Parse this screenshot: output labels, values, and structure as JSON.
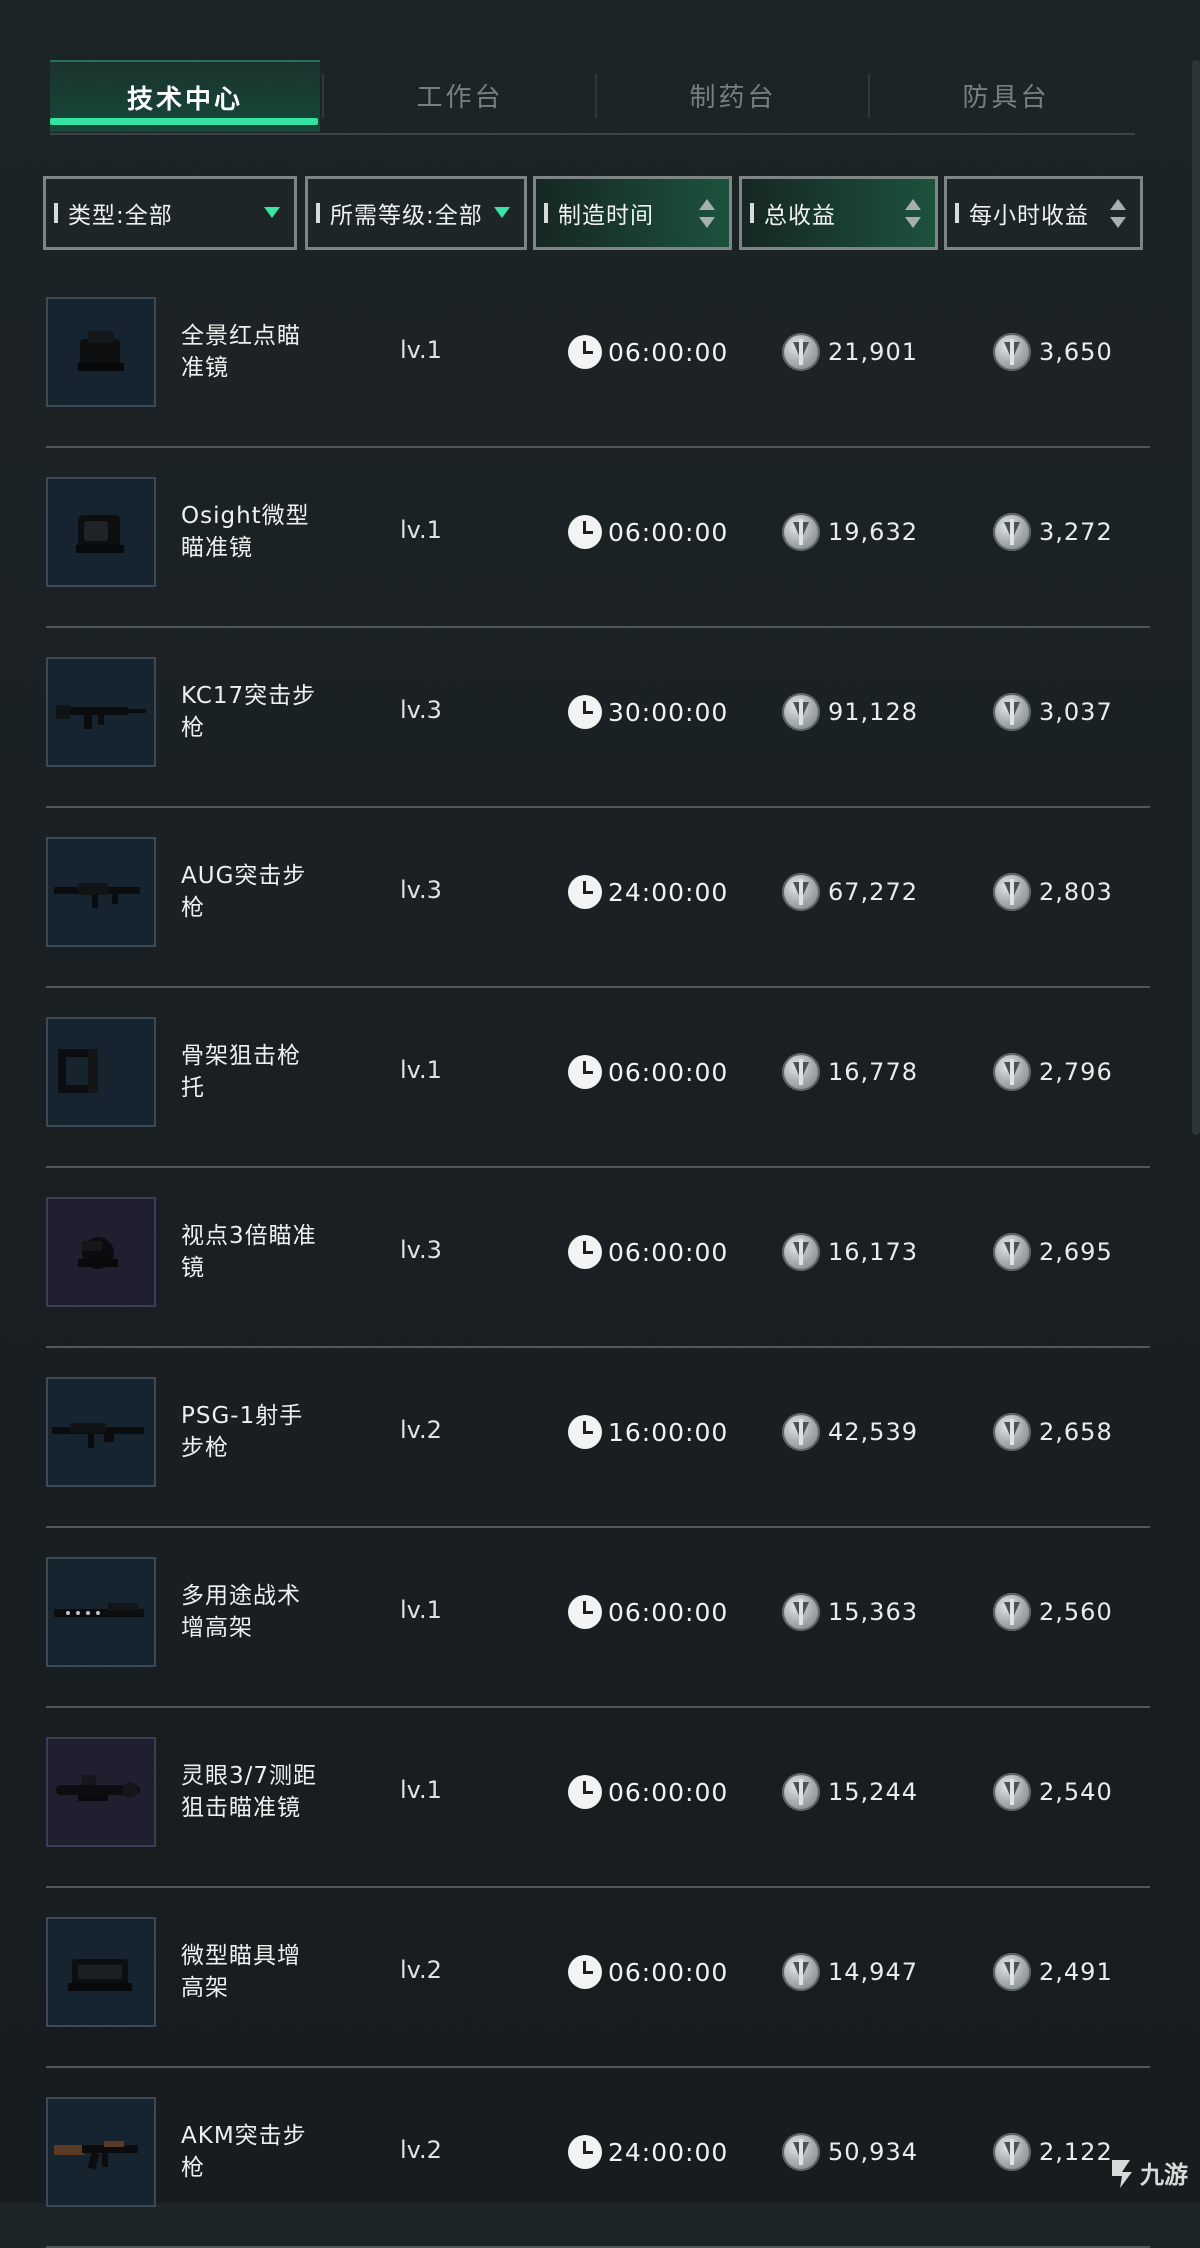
{
  "tabs": [
    {
      "label": "技术中心",
      "active": true
    },
    {
      "label": "工作台",
      "active": false
    },
    {
      "label": "制药台",
      "active": false
    },
    {
      "label": "防具台",
      "active": false
    }
  ],
  "filters": {
    "type": "类型:全部",
    "level": "所需等级:全部",
    "craft_time": "制造时间",
    "total_income": "总收益",
    "hourly_income": "每小时收益"
  },
  "colors": {
    "accent": "#34e3a4",
    "background": "#1b2124"
  },
  "items": [
    {
      "name": "全景红点瞄准镜",
      "level": "lv.1",
      "time": "06:00:00",
      "total": "21,901",
      "hourly": "3,650",
      "icon": "red-dot-sight-icon"
    },
    {
      "name": "Osight微型瞄准镜",
      "level": "lv.1",
      "time": "06:00:00",
      "total": "19,632",
      "hourly": "3,272",
      "icon": "micro-sight-icon"
    },
    {
      "name": "KC17突击步枪",
      "level": "lv.3",
      "time": "30:00:00",
      "total": "91,128",
      "hourly": "3,037",
      "icon": "rifle-icon"
    },
    {
      "name": "AUG突击步枪",
      "level": "lv.3",
      "time": "24:00:00",
      "total": "67,272",
      "hourly": "2,803",
      "icon": "rifle-icon"
    },
    {
      "name": "骨架狙击枪托",
      "level": "lv.1",
      "time": "06:00:00",
      "total": "16,778",
      "hourly": "2,796",
      "icon": "stock-icon"
    },
    {
      "name": "视点3倍瞄准镜",
      "level": "lv.3",
      "time": "06:00:00",
      "total": "16,173",
      "hourly": "2,695",
      "icon": "scope-icon"
    },
    {
      "name": "PSG-1射手步枪",
      "level": "lv.2",
      "time": "16:00:00",
      "total": "42,539",
      "hourly": "2,658",
      "icon": "rifle-icon"
    },
    {
      "name": "多用途战术增高架",
      "level": "lv.1",
      "time": "06:00:00",
      "total": "15,363",
      "hourly": "2,560",
      "icon": "riser-mount-icon"
    },
    {
      "name": "灵眼3/7测距狙击瞄准镜",
      "level": "lv.1",
      "time": "06:00:00",
      "total": "15,244",
      "hourly": "2,540",
      "icon": "sniper-scope-icon"
    },
    {
      "name": "微型瞄具增高架",
      "level": "lv.2",
      "time": "06:00:00",
      "total": "14,947",
      "hourly": "2,491",
      "icon": "riser-mount-icon"
    },
    {
      "name": "AKM突击步枪",
      "level": "lv.2",
      "time": "24:00:00",
      "total": "50,934",
      "hourly": "2,122",
      "icon": "ak-rifle-icon"
    }
  ],
  "watermark": "九游"
}
